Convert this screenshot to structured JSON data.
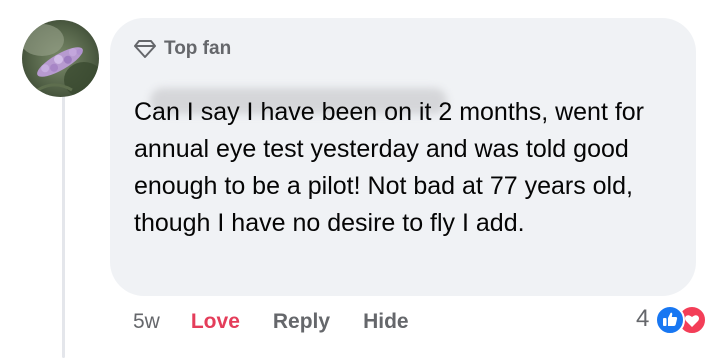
{
  "comment": {
    "badge": {
      "label": "Top fan",
      "icon": "diamond-icon"
    },
    "author_name_hidden": true,
    "text": "Can I say I have been on it 2 months, went for annual eye test yesterday and was told good enough to be a pilot! Not bad at 77 years old, though I have no desire to fly I add.",
    "actions": {
      "time": "5w",
      "love_label": "Love",
      "reply_label": "Reply",
      "hide_label": "Hide"
    },
    "reactions": {
      "count": "4",
      "types": [
        "like-icon",
        "love-icon"
      ]
    }
  },
  "colors": {
    "bubble_bg": "#f0f2f5",
    "secondary_text": "#65676b",
    "love_red": "#e43d5a",
    "like_blue": "#1877f2",
    "love_reaction": "#f33e58"
  }
}
